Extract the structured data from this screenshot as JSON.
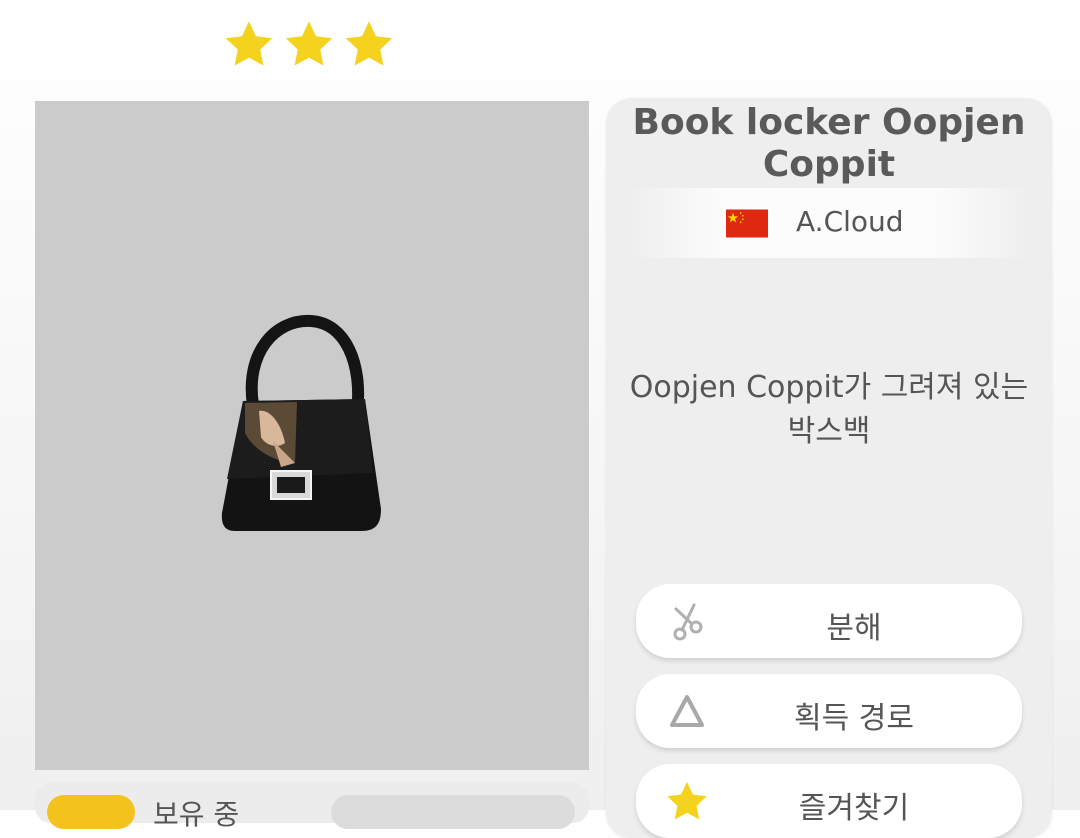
{
  "rarity": {
    "stars": 3,
    "star_color": "#f5d21e"
  },
  "item": {
    "name": "Book locker Oopjen Coppit",
    "maker": {
      "flag_icon": "china-flag-icon",
      "name": "A.Cloud"
    },
    "description": "Oopjen Coppit가 그려져 있는 박스백",
    "image_background": "#cbcbcb"
  },
  "actions": [
    {
      "label": "분해",
      "icon": "scissors-icon"
    },
    {
      "label": "획득 경로",
      "icon": "triangle-icon"
    },
    {
      "label": "즐겨찾기",
      "icon": "star-icon"
    }
  ],
  "owned": {
    "label": "보유 중"
  }
}
